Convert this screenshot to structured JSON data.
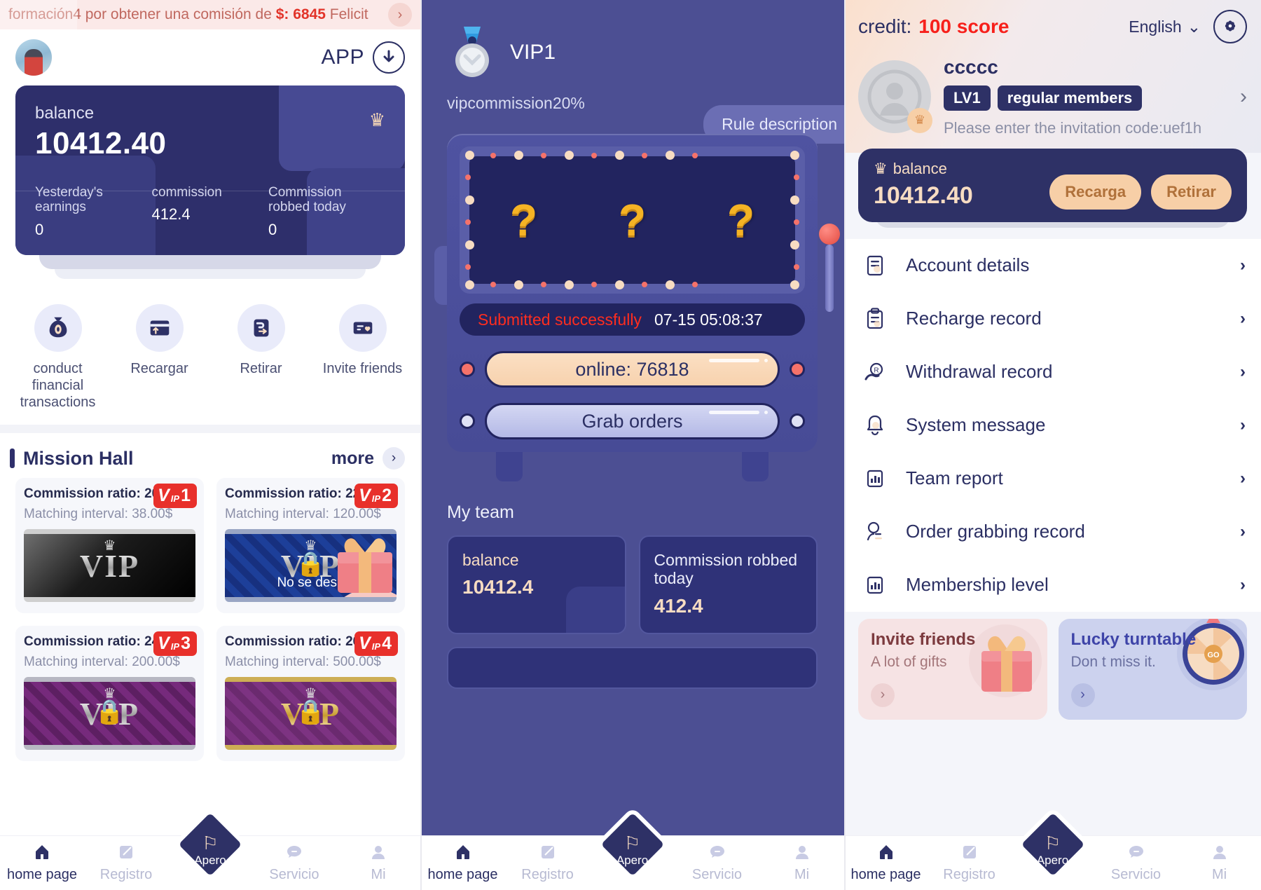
{
  "left": {
    "marquee": {
      "text_prefix": "formación",
      "text": "4 por obtener una comisión de ",
      "amount": "$: 6845",
      "text_suffix": " Felicit",
      "arrow_icon": "chevron-right-icon"
    },
    "header": {
      "app_label": "APP",
      "download_icon": "download-arrow-icon"
    },
    "balance_card": {
      "label": "balance",
      "value": "10412.40",
      "crown_icon": "crown-icon",
      "stats": [
        {
          "key": "Yesterday's earnings",
          "value": "0"
        },
        {
          "key": "commission",
          "value": "412.4"
        },
        {
          "key": "Commission robbed today",
          "value": "0"
        }
      ]
    },
    "quick_actions": [
      {
        "label": "conduct financial transactions",
        "icon": "money-bag-icon"
      },
      {
        "label": "Recargar",
        "icon": "card-up-icon"
      },
      {
        "label": "Retirar",
        "icon": "wallet-out-icon"
      },
      {
        "label": "Invite friends",
        "icon": "card-heart-icon"
      }
    ],
    "mission": {
      "title": "Mission Hall",
      "more_label": "more",
      "more_icon": "chevron-right-icon",
      "cards": [
        {
          "ratio_label": "Commission ratio:",
          "ratio": "20%",
          "interval_label": "Matching interval:",
          "interval": "38.00$",
          "badge_v": "V",
          "badge_ip": "IP",
          "badge_num": "1",
          "locked": false,
          "locked_text": "",
          "art": "silver"
        },
        {
          "ratio_label": "Commission ratio:",
          "ratio": "22%",
          "interval_label": "Matching interval:",
          "interval": "120.00$",
          "badge_v": "V",
          "badge_ip": "IP",
          "badge_num": "2",
          "locked": true,
          "locked_text": "No se desb",
          "art": "blue"
        },
        {
          "ratio_label": "Commission ratio:",
          "ratio": "24%",
          "interval_label": "Matching interval:",
          "interval": "200.00$",
          "badge_v": "V",
          "badge_ip": "IP",
          "badge_num": "3",
          "locked": true,
          "locked_text": "",
          "art": "purple"
        },
        {
          "ratio_label": "Commission ratio:",
          "ratio": "26%",
          "interval_label": "Matching interval:",
          "interval": "500.00$",
          "badge_v": "V",
          "badge_ip": "IP",
          "badge_num": "4",
          "locked": true,
          "locked_text": "",
          "art": "gold"
        }
      ]
    }
  },
  "mid": {
    "vip_title": "VIP1",
    "vip_commission": "vipcommission20%",
    "rule_button": "Rule description",
    "medal_icon": "medal-icon",
    "reels": [
      "?",
      "?",
      "?"
    ],
    "status": {
      "message": "Submitted successfully",
      "timestamp": "07-15 05:08:37"
    },
    "online_pill": "online:  76818",
    "grab_button": "Grab orders",
    "team_title": "My team",
    "team_cards": [
      {
        "key": "balance",
        "value": "10412.4"
      },
      {
        "key": "Commission robbed today",
        "value": "412.4"
      }
    ]
  },
  "right": {
    "credit_label": "credit:",
    "credit_value": "100 score",
    "language": "English",
    "language_caret_icon": "chevron-down-icon",
    "gear_icon": "gear-icon",
    "user": {
      "name": "ccccc",
      "level_tag": "LV1",
      "member_tag": "regular members",
      "invitation_hint": "Please enter the invitation code:uef1h",
      "arrow_icon": "chevron-right-icon",
      "avatar_icon": "user-avatar-icon",
      "crown_badge_icon": "crown-icon"
    },
    "balance": {
      "label": "balance",
      "crown_icon": "crown-icon",
      "value": "10412.40",
      "recharge_button": "Recarga",
      "withdraw_button": "Retirar"
    },
    "menu": [
      {
        "label": "Account details",
        "icon": "document-lines-icon"
      },
      {
        "label": "Recharge record",
        "icon": "clipboard-icon"
      },
      {
        "label": "Withdrawal record",
        "icon": "hand-coin-icon"
      },
      {
        "label": "System message",
        "icon": "bell-icon"
      },
      {
        "label": "Team report",
        "icon": "bar-chart-icon"
      },
      {
        "label": "Order grabbing record",
        "icon": "person-line-icon"
      },
      {
        "label": "Membership level",
        "icon": "bar-chart-icon"
      }
    ],
    "promos": [
      {
        "title": "Invite friends",
        "subtitle": "A lot of gifts",
        "arrow_icon": "chevron-right-icon",
        "art": "gift-box-icon"
      },
      {
        "title": "Lucky turntable",
        "subtitle": "Don t miss it.",
        "arrow_icon": "chevron-right-icon",
        "art": "fortune-wheel-icon",
        "wheel_label": "GO"
      }
    ]
  },
  "tabbar": {
    "items": [
      {
        "label": "home page",
        "icon": "home-icon",
        "active": true
      },
      {
        "label": "Registro",
        "icon": "note-edit-icon",
        "active": false
      },
      {
        "label": "Apero",
        "icon": "flag-icon",
        "center": true
      },
      {
        "label": "Servicio",
        "icon": "chat-icon",
        "active": false
      },
      {
        "label": "Mi",
        "icon": "person-icon",
        "active": false
      }
    ]
  },
  "colors": {
    "brand_navy": "#2e3166",
    "accent_peach": "#f7cfa7",
    "alert_red": "#e8302b",
    "mid_bg": "#4c4f93"
  }
}
